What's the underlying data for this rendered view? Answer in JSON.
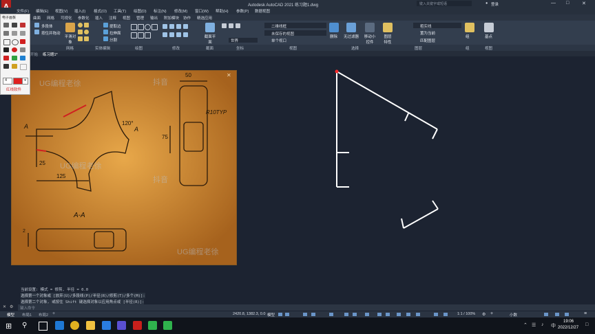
{
  "app": {
    "title": "Autodesk AutoCAD 2021    练习题1.dwg",
    "search_placeholder": "键入关键字或短语",
    "user": "登录"
  },
  "menu": [
    "文件(F)",
    "编辑(E)",
    "视图(V)",
    "插入(I)",
    "格式(O)",
    "工具(T)",
    "绘图(D)",
    "标注(N)",
    "修改(M)",
    "窗口(W)",
    "帮助(H)",
    "参数(P)",
    "数据视图"
  ],
  "ribbon_tabs": [
    "默认",
    "实体",
    "曲面",
    "网格",
    "可视化",
    "参数化",
    "插入",
    "注释",
    "视图",
    "管理",
    "输出",
    "附加模块",
    "协作",
    "精选应用"
  ],
  "ribbon": {
    "buttons": [
      "多段体",
      "按住并拖动",
      "平滑对象",
      "提取边",
      "拉伸面",
      "分割",
      "截面平面",
      "二维线框",
      "未保存的视图",
      "单个视口",
      "世界",
      "删除",
      "无过滤器",
      "移动小控件",
      "图层特性",
      "粗实线",
      "置为当前",
      "匹配图层",
      "组",
      "基点"
    ],
    "panels": [
      "网格",
      "实体编辑",
      "绘图",
      "修改",
      "截面",
      "坐标",
      "视图",
      "选择",
      "图层",
      "组",
      "视图"
    ]
  },
  "file_tabs": [
    "开始",
    "练习题1*"
  ],
  "palette": {
    "title": "电子画板",
    "label": "红线软件",
    "size": "4"
  },
  "reference_image": {
    "dims": [
      "50",
      "R10TYP",
      "120°",
      "75",
      "25",
      "125",
      "A",
      "A",
      "A-A",
      "2"
    ],
    "watermark": "UG编程老徐",
    "watermark2": "抖音"
  },
  "command": {
    "lines": [
      "当前设置: 模式 = 修剪, 半径 = 0.0",
      "选择第一个对象或 [放弃(U)/多段线(P)/半径(R)/修剪(T)/多个(M)]:",
      "选择第二个对象, 或按住 Shift 键选择对象以应用角点或 [半径(R)]:"
    ],
    "prompt": "键入命令"
  },
  "layout_tabs": [
    "模型",
    "布局1",
    "布局2"
  ],
  "status": {
    "coords": "2420.8, 1382.3, 0.0",
    "mode": "模型",
    "scale": "1:1 / 100%",
    "units": "小数"
  },
  "taskbar": {
    "time": "19:06",
    "date": "2022/12/27"
  }
}
